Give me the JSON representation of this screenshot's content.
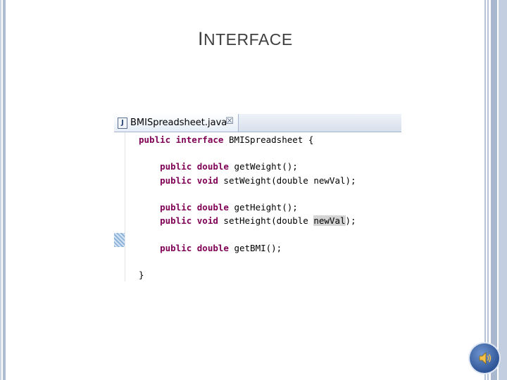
{
  "slide": {
    "title_first_letter": "I",
    "title_rest": "NTERFACE"
  },
  "editor": {
    "tab_label": "BMISpreadsheet.java",
    "tab_icon": "java-file-icon",
    "close_glyph": "☒",
    "code_lines": [
      {
        "kw": "public interface",
        "rest": " BMISpreadsheet {"
      },
      {
        "kw": "",
        "rest": ""
      },
      {
        "kw": "    public double",
        "rest": " getWeight();"
      },
      {
        "kw": "    public void",
        "rest": " setWeight(double newVal);"
      },
      {
        "kw": "",
        "rest": ""
      },
      {
        "kw": "    public double",
        "rest": " getHeight();"
      },
      {
        "kw": "    public void",
        "rest": " setHeight(double ",
        "hl": "newVal",
        "tail": ");"
      },
      {
        "kw": "",
        "rest": ""
      },
      {
        "kw": "    public double",
        "rest": " getBMI();"
      },
      {
        "kw": "",
        "rest": ""
      },
      {
        "kw": "",
        "rest": "}"
      }
    ]
  },
  "colors": {
    "keyword": "#7f0055",
    "title": "#404040",
    "speaker": "#2f5597"
  },
  "icons": {
    "speaker": "speaker-sound-icon"
  }
}
